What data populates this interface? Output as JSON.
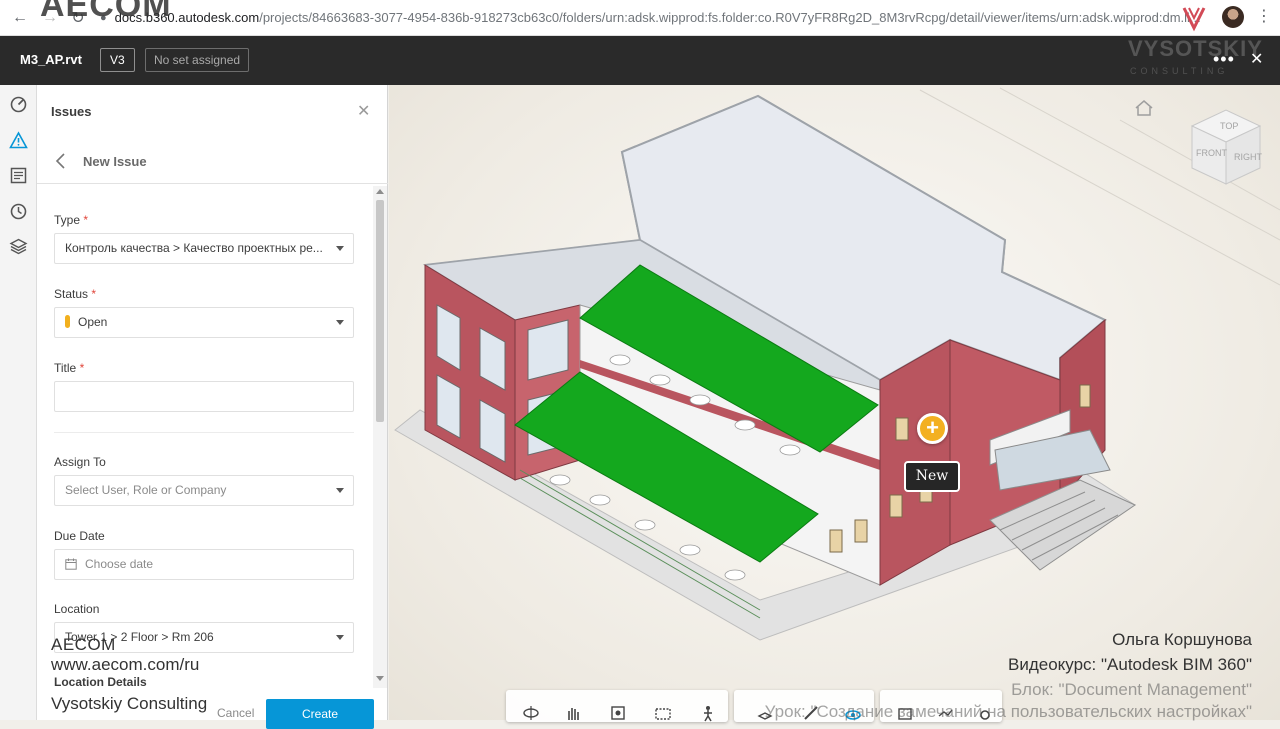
{
  "browser": {
    "url_domain": "docs.b360.autodesk.com",
    "url_path": "/projects/84663683-3077-4954-836b-918273cb63c0/folders/urn:adsk.wipprod:fs.folder:co.R0V7yFR8Rg2D_8M3rvRcpg/detail/viewer/items/urn:adsk.wipprod:dm.li...",
    "overlay_text": "AECOM"
  },
  "header": {
    "file_name": "M3_AP.rvt",
    "version": "V3",
    "set_status": "No set assigned",
    "watermark_brand": "VYSOTSKIY",
    "watermark_sub": "CONSULTING"
  },
  "panel": {
    "title": "Issues",
    "subtitle": "New Issue",
    "fields": {
      "type_label": "Type",
      "type_value": "Контроль качества > Качество проектных ре...",
      "status_label": "Status",
      "status_value": "Open",
      "title_label": "Title",
      "title_value": "",
      "assign_label": "Assign To",
      "assign_placeholder": "Select User, Role or Company",
      "due_label": "Due Date",
      "due_placeholder": "Choose date",
      "location_label": "Location",
      "location_value": "Tower 1 > 2 Floor > Rm 206",
      "location_details_label": "Location Details",
      "required_mark": "*"
    },
    "cancel_label": "Cancel",
    "create_label": "Create"
  },
  "viewer": {
    "new_label": "New",
    "viewcube_labels": {
      "top": "TOP",
      "front": "FRONT",
      "right": "RIGHT"
    }
  },
  "watermark": {
    "company": "AECOM",
    "website": "www.aecom.com/ru",
    "consultant": "Vysotskiy Consulting"
  },
  "credits": {
    "author": "Ольга Коршунова",
    "course": "Видеокурс: \"Autodesk BIM 360\"",
    "block": "Блок: \"Document Management\"",
    "lesson": "Урок: \"Создание замечаний на пользовательских настройках\""
  },
  "colors": {
    "accent": "#0696d7",
    "status_open": "#f2b01e",
    "marker": "#f3b021",
    "roof_green": "#14a81e",
    "wall_red": "#b9555f"
  }
}
